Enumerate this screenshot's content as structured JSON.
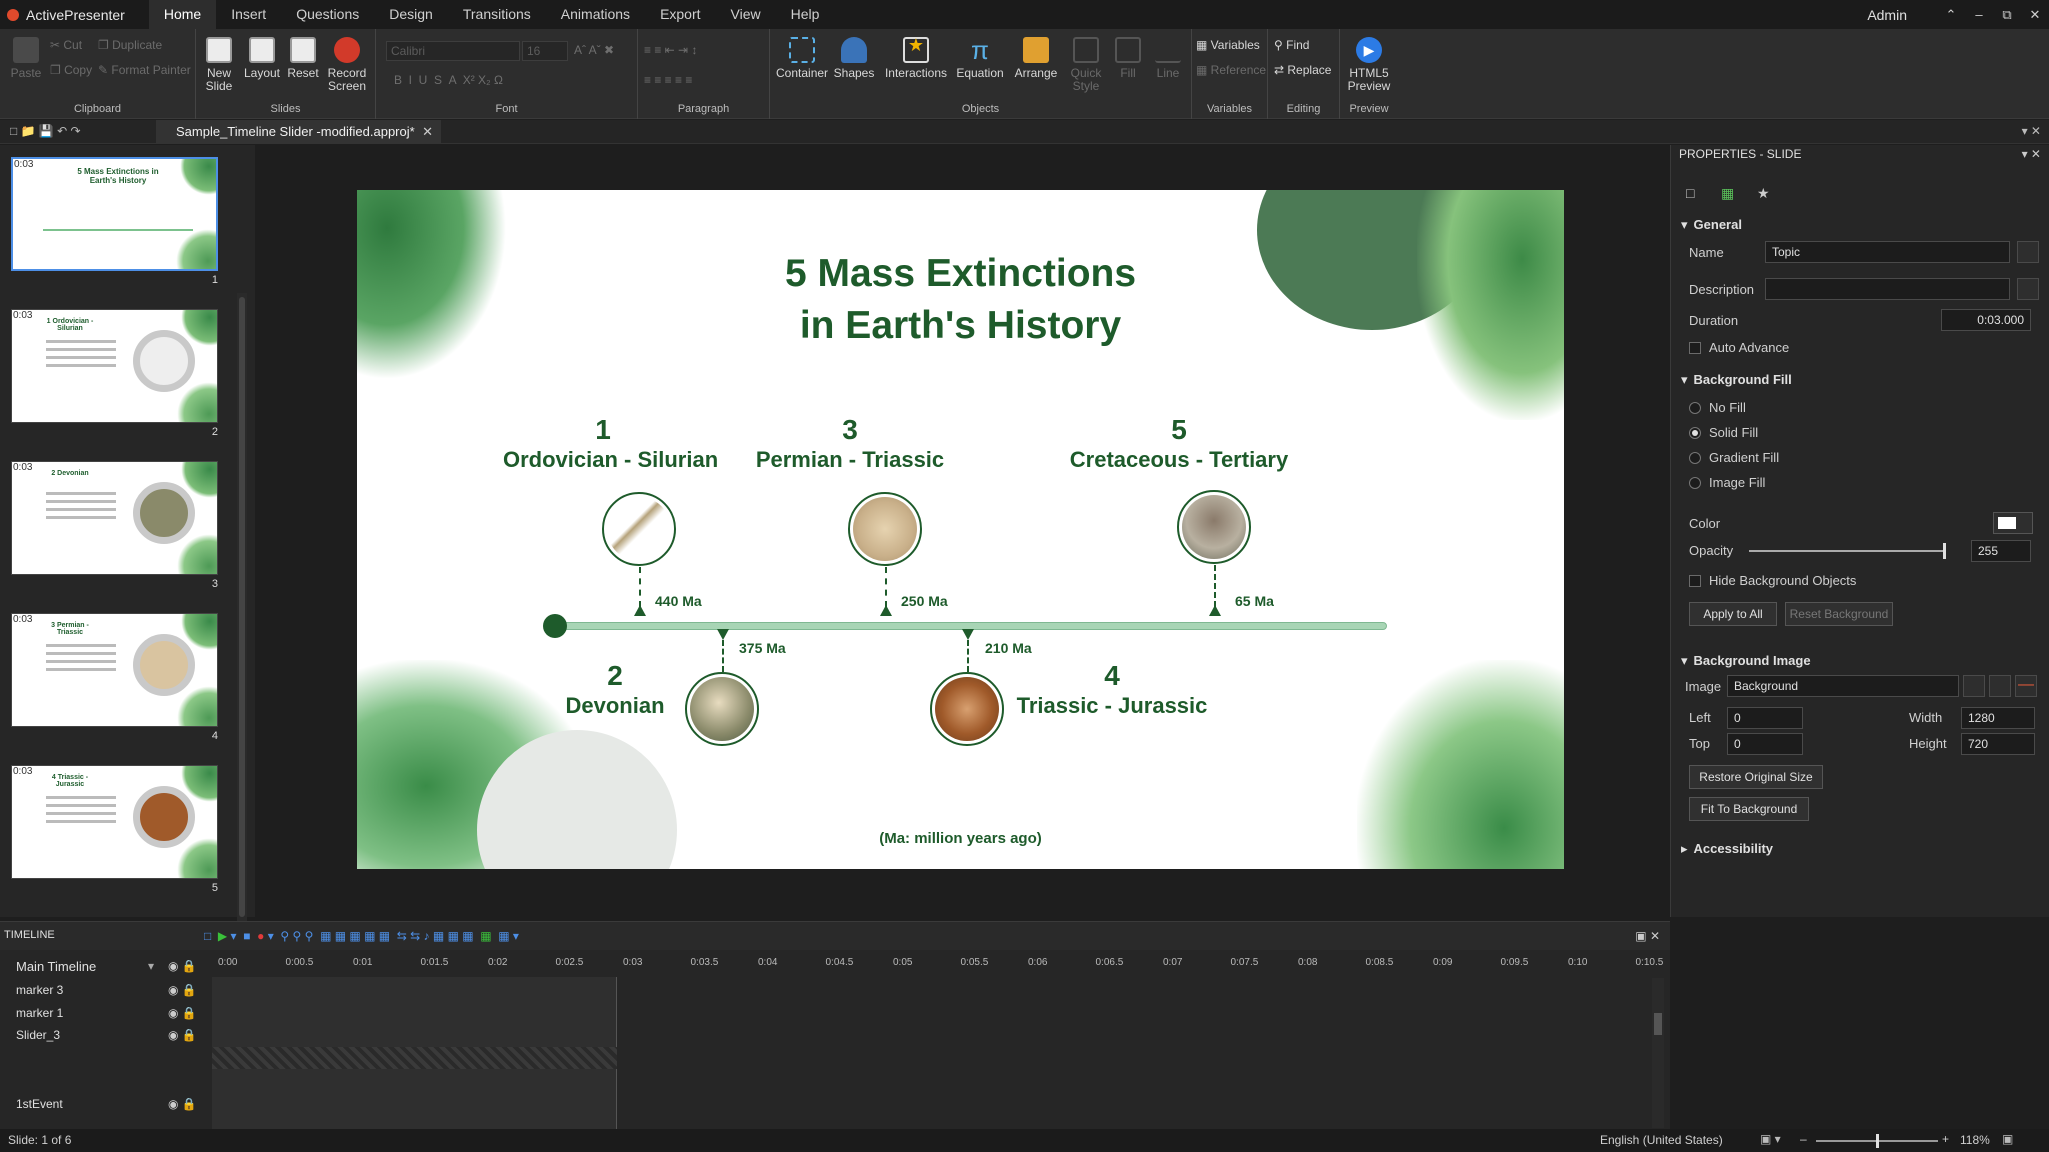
{
  "app": {
    "name": "ActivePresenter",
    "user": "Admin"
  },
  "menu": [
    "Home",
    "Insert",
    "Questions",
    "Design",
    "Transitions",
    "Animations",
    "Export",
    "View",
    "Help"
  ],
  "ribbon": {
    "clipboard": {
      "label": "Clipboard",
      "paste": "Paste",
      "cut": "Cut",
      "copy": "Copy",
      "duplicate": "Duplicate",
      "format_painter": "Format Painter"
    },
    "slides": {
      "label": "Slides",
      "new_slide": "New Slide",
      "layout": "Layout",
      "reset": "Reset",
      "record_screen": "Record Screen"
    },
    "font": {
      "label": "Font",
      "family": "Calibri",
      "size": "16"
    },
    "paragraph": {
      "label": "Paragraph"
    },
    "objects": {
      "label": "Objects",
      "container": "Container",
      "shapes": "Shapes",
      "interactions": "Interactions",
      "equation": "Equation",
      "arrange": "Arrange",
      "quick_style": "Quick Style",
      "fill": "Fill",
      "line": "Line"
    },
    "variables": {
      "label": "Variables",
      "variables": "Variables",
      "reference": "Reference"
    },
    "editing": {
      "label": "Editing",
      "find": "Find",
      "replace": "Replace"
    },
    "preview": {
      "label": "Preview",
      "html5": "HTML5 Preview"
    }
  },
  "doc_tab": "Sample_Timeline Slider -modified.approj*",
  "thumbnails": [
    {
      "num": "1",
      "dur": "0:03",
      "title": "5 Mass Extinctions in Earth's History"
    },
    {
      "num": "2",
      "dur": "0:03",
      "title": "1 Ordovician - Silurian"
    },
    {
      "num": "3",
      "dur": "0:03",
      "title": "2 Devonian"
    },
    {
      "num": "4",
      "dur": "0:03",
      "title": "3 Permian - Triassic"
    },
    {
      "num": "5",
      "dur": "0:03",
      "title": "4 Triassic - Jurassic"
    }
  ],
  "slide": {
    "title1": "5 Mass Extinctions",
    "title2": "in Earth's History",
    "events": [
      {
        "num": "1",
        "name": "Ordovician - Silurian",
        "ma": "440 Ma"
      },
      {
        "num": "2",
        "name": "Devonian",
        "ma": "375 Ma"
      },
      {
        "num": "3",
        "name": "Permian - Triassic",
        "ma": "250 Ma"
      },
      {
        "num": "4",
        "name": "Triassic - Jurassic",
        "ma": "210 Ma"
      },
      {
        "num": "5",
        "name": "Cretaceous - Tertiary",
        "ma": "65 Ma"
      }
    ],
    "footnote": "(Ma: million years ago)"
  },
  "properties": {
    "title": "PROPERTIES - SLIDE",
    "general": "General",
    "name_label": "Name",
    "name_value": "Topic",
    "description_label": "Description",
    "duration_label": "Duration",
    "duration_value": "0:03.000",
    "auto_advance": "Auto Advance",
    "bg_fill": "Background Fill",
    "no_fill": "No Fill",
    "solid_fill": "Solid Fill",
    "gradient_fill": "Gradient Fill",
    "image_fill": "Image Fill",
    "color_label": "Color",
    "color_value": "#ffffff",
    "opacity_label": "Opacity",
    "opacity_value": "255",
    "hide_bg": "Hide Background Objects",
    "apply_all": "Apply to All",
    "reset_bg": "Reset Background",
    "bg_image": "Background Image",
    "image_label": "Image",
    "image_value": "Background",
    "left_label": "Left",
    "left_value": "0",
    "top_label": "Top",
    "top_value": "0",
    "width_label": "Width",
    "width_value": "1280",
    "height_label": "Height",
    "height_value": "720",
    "restore": "Restore Original Size",
    "fit": "Fit To Background",
    "accessibility": "Accessibility"
  },
  "timeline": {
    "title": "TIMELINE",
    "main": "Main Timeline",
    "ticks": [
      "0:00",
      "0:00.5",
      "0:01",
      "0:01.5",
      "0:02",
      "0:02.5",
      "0:03",
      "0:03.5",
      "0:04",
      "0:04.5",
      "0:05",
      "0:05.5",
      "0:06",
      "0:06.5",
      "0:07",
      "0:07.5",
      "0:08",
      "0:08.5",
      "0:09",
      "0:09.5",
      "0:10",
      "0:10.5"
    ],
    "tracks": [
      "marker 3",
      "marker 1",
      "Slider_3",
      "",
      "",
      "1stEvent"
    ]
  },
  "status": {
    "slide": "Slide: 1 of 6",
    "language": "English (United States)",
    "zoom": "118%"
  },
  "colors": {
    "accent": "#1e5b2b",
    "timeline_bar": "#a8d5b5",
    "selection": "#4d8fe6"
  }
}
